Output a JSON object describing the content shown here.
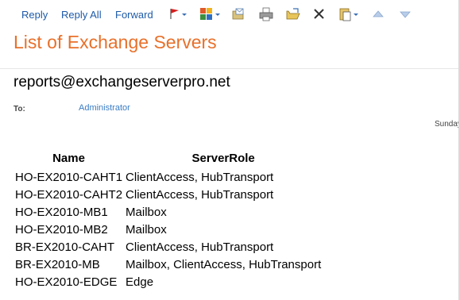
{
  "toolbar": {
    "reply_label": "Reply",
    "reply_all_label": "Reply All",
    "forward_label": "Forward",
    "icons": [
      "flag-icon",
      "categorize-icon",
      "move-icon",
      "print-icon",
      "open-folder-icon",
      "delete-icon",
      "paste-icon",
      "previous-up-icon",
      "next-down-icon"
    ]
  },
  "message": {
    "subject": "List of Exchange Servers",
    "from": "reports@exchangeserverpro.net",
    "to_label": "To:",
    "to_value": "Administrator",
    "date": "Sunday"
  },
  "table": {
    "headers": [
      "Name",
      "ServerRole"
    ],
    "rows": [
      [
        "HO-EX2010-CAHT1",
        "ClientAccess, HubTransport"
      ],
      [
        "HO-EX2010-CAHT2",
        "ClientAccess, HubTransport"
      ],
      [
        "HO-EX2010-MB1",
        "Mailbox"
      ],
      [
        "HO-EX2010-MB2",
        "Mailbox"
      ],
      [
        "BR-EX2010-CAHT",
        "ClientAccess, HubTransport"
      ],
      [
        "BR-EX2010-MB",
        "Mailbox, ClientAccess, HubTransport"
      ],
      [
        "HO-EX2010-EDGE",
        "Edge"
      ]
    ]
  },
  "colors": {
    "title": "#e8702a",
    "link": "#1e5aa8",
    "recipient": "#3a7cc4"
  }
}
